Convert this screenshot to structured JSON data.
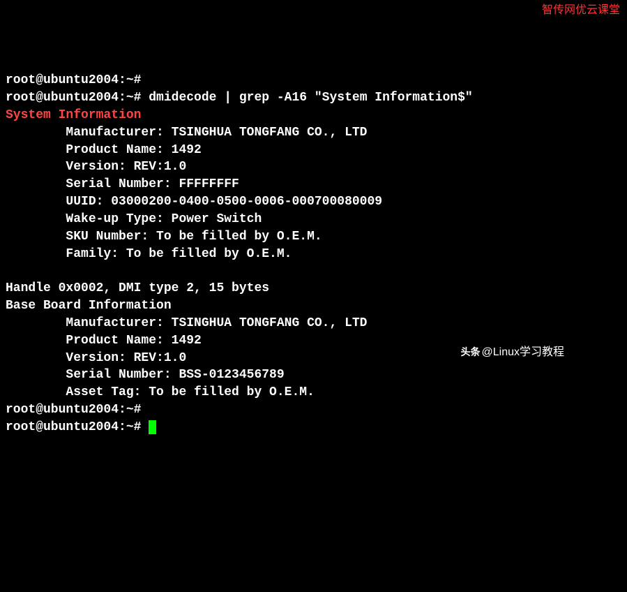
{
  "watermarks": {
    "top_right": "智传网优云课堂",
    "bottom_right": "@Linux学习教程",
    "toutiao_label": "头条"
  },
  "prompts": {
    "user": "root",
    "host": "ubuntu2004",
    "path": "~",
    "suffix": "#"
  },
  "lines": {
    "l1_prompt": "root@ubuntu2004:~#",
    "l2_prompt": "root@ubuntu2004:~#",
    "l2_cmd": " dmidecode | grep -A16 \"System Information$\"",
    "l3_header": "System Information",
    "l4": "        Manufacturer: TSINGHUA TONGFANG CO., LTD",
    "l5": "        Product Name: 1492",
    "l6": "        Version: REV:1.0",
    "l7": "        Serial Number: FFFFFFFF",
    "l8": "        UUID: 03000200-0400-0500-0006-000700080009",
    "l9": "        Wake-up Type: Power Switch",
    "l10": "        SKU Number: To be filled by O.E.M.",
    "l11": "        Family: To be filled by O.E.M.",
    "l12": "",
    "l13": "Handle 0x0002, DMI type 2, 15 bytes",
    "l14": "Base Board Information",
    "l15": "        Manufacturer: TSINGHUA TONGFANG CO., LTD",
    "l16": "        Product Name: 1492",
    "l17": "        Version: REV:1.0",
    "l18": "        Serial Number: BSS-0123456789",
    "l19": "        Asset Tag: To be filled by O.E.M.",
    "l20_prompt": "root@ubuntu2004:~#",
    "l21_prompt": "root@ubuntu2004:~# "
  }
}
